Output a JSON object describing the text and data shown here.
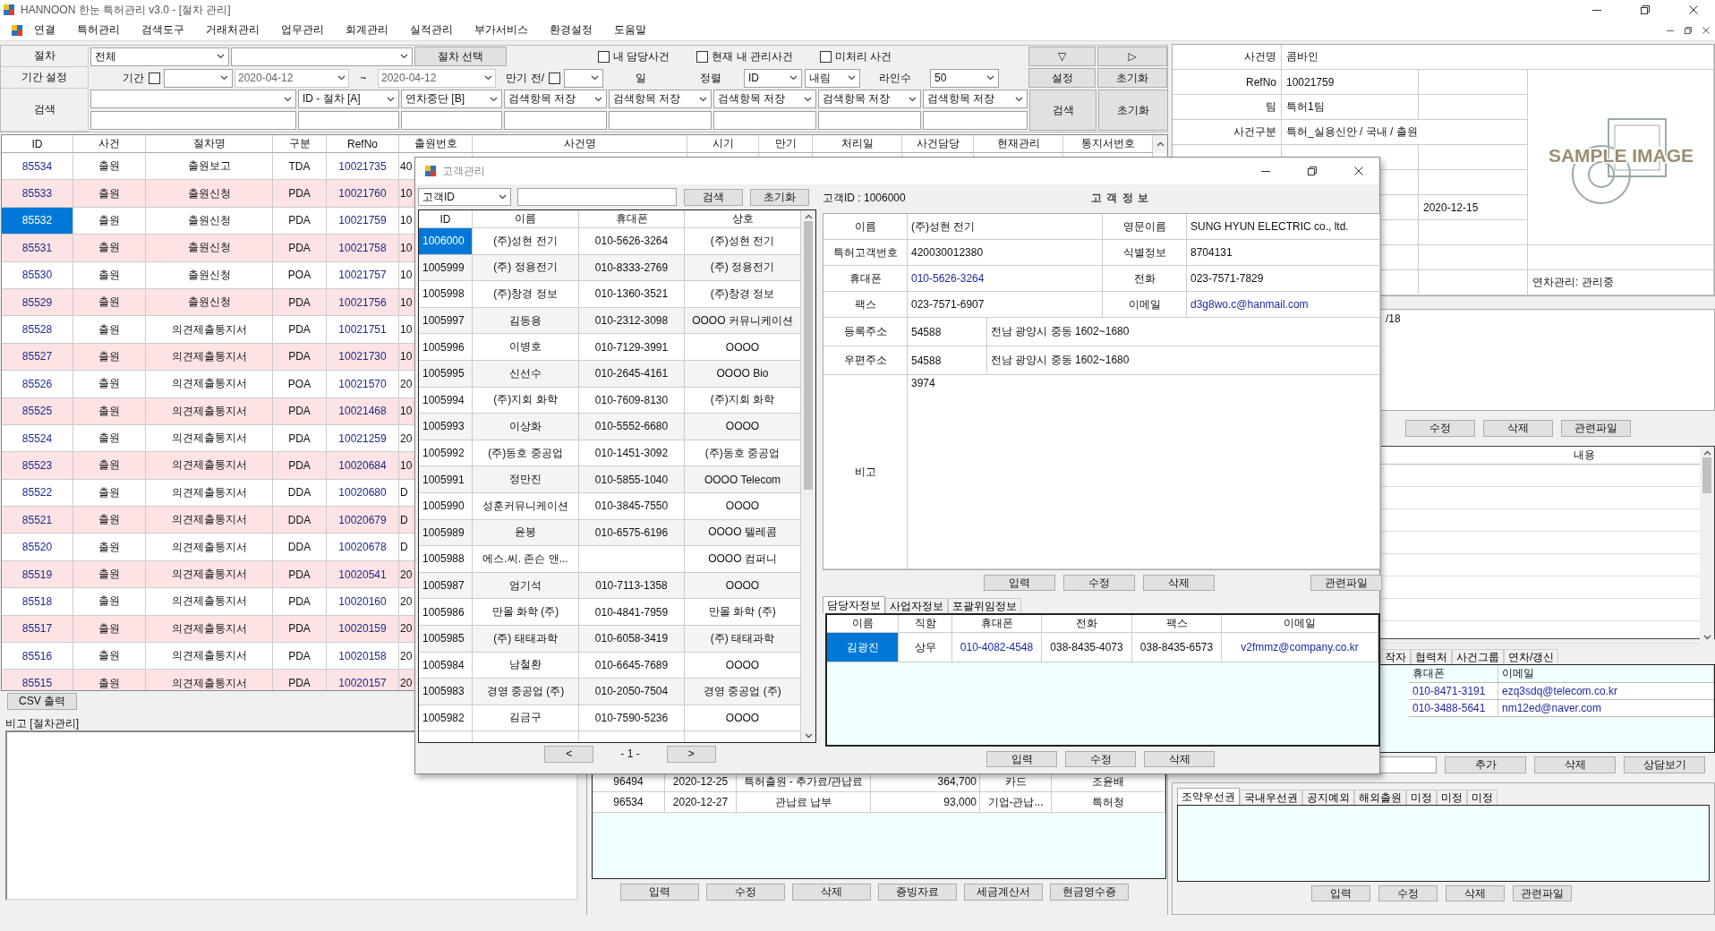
{
  "window": {
    "title": "HANNOON 한눈 특허관리 v3.0 - [절차 관리]"
  },
  "menu": [
    "연결",
    "특허관리",
    "검색도구",
    "거래처관리",
    "업무관리",
    "회계관리",
    "실적관리",
    "부가서비스",
    "환경설정",
    "도움말"
  ],
  "filter": {
    "row1": {
      "label": "절차",
      "procedure": "전체",
      "button": "절차 선택",
      "checkboxes": [
        {
          "label": "내 담당사건",
          "checked": false
        },
        {
          "label": "현재 내 관리사건",
          "checked": false
        },
        {
          "label": "미처리 사건",
          "checked": false
        }
      ],
      "nav_buttons": [
        "▽",
        "▷"
      ]
    },
    "row2": {
      "label": "기간 설정",
      "period_label": "기간",
      "period_checked": false,
      "date_from": "2020-04-12",
      "tilde": "~",
      "date_to": "2020-04-12",
      "due_label": "만기 전/",
      "due_checked": false,
      "day_label": "일",
      "sort_label": "정렬",
      "sort_field": "ID",
      "sort_order": "내림",
      "lines_label": "라인수",
      "lines": "50",
      "buttons": [
        "설정",
        "초기화"
      ]
    },
    "row3": {
      "label": "검색",
      "combos": [
        "ID - 절차  [A]",
        "연차중단  [B]",
        "검색항목 저장",
        "검색항목 저장",
        "검색항목 저장",
        "검색항목 저장",
        "검색항목 저장"
      ],
      "buttons": [
        "검색",
        "초기화"
      ]
    }
  },
  "procedure_table": {
    "columns": [
      "ID",
      "사건",
      "절차명",
      "구분",
      "RefNo",
      "출원번호",
      "사건명",
      "시기",
      "만기",
      "처리일",
      "사건담당",
      "현재관리",
      "통지서번호"
    ],
    "rows": [
      {
        "id": "85534",
        "case": "출원",
        "procedure": "출원보고",
        "type": "TDA",
        "ref_no": "10021735",
        "app_no": "40",
        "selected": false
      },
      {
        "id": "85533",
        "case": "출원",
        "procedure": "출원신청",
        "type": "PDA",
        "ref_no": "10021760",
        "app_no": "10",
        "selected": false
      },
      {
        "id": "85532",
        "case": "출원",
        "procedure": "출원신청",
        "type": "PDA",
        "ref_no": "10021759",
        "app_no": "10",
        "selected": true
      },
      {
        "id": "85531",
        "case": "출원",
        "procedure": "출원신청",
        "type": "PDA",
        "ref_no": "10021758",
        "app_no": "10",
        "selected": false
      },
      {
        "id": "85530",
        "case": "출원",
        "procedure": "출원신청",
        "type": "POA",
        "ref_no": "10021757",
        "app_no": "10",
        "selected": false
      },
      {
        "id": "85529",
        "case": "출원",
        "procedure": "출원신청",
        "type": "PDA",
        "ref_no": "10021756",
        "app_no": "10",
        "selected": false
      },
      {
        "id": "85528",
        "case": "출원",
        "procedure": "의견제출통지서",
        "type": "PDA",
        "ref_no": "10021751",
        "app_no": "10",
        "selected": false
      },
      {
        "id": "85527",
        "case": "출원",
        "procedure": "의견제출통지서",
        "type": "PDA",
        "ref_no": "10021730",
        "app_no": "10",
        "selected": false
      },
      {
        "id": "85526",
        "case": "출원",
        "procedure": "의견제출통지서",
        "type": "POA",
        "ref_no": "10021570",
        "app_no": "20",
        "selected": false
      },
      {
        "id": "85525",
        "case": "출원",
        "procedure": "의견제출통지서",
        "type": "PDA",
        "ref_no": "10021468",
        "app_no": "10",
        "selected": false
      },
      {
        "id": "85524",
        "case": "출원",
        "procedure": "의견제출통지서",
        "type": "PDA",
        "ref_no": "10021259",
        "app_no": "20",
        "selected": false
      },
      {
        "id": "85523",
        "case": "출원",
        "procedure": "의견제출통지서",
        "type": "PDA",
        "ref_no": "10020684",
        "app_no": "10",
        "selected": false
      },
      {
        "id": "85522",
        "case": "출원",
        "procedure": "의견제출통지서",
        "type": "DDA",
        "ref_no": "10020680",
        "app_no": "D",
        "selected": false
      },
      {
        "id": "85521",
        "case": "출원",
        "procedure": "의견제출통지서",
        "type": "DDA",
        "ref_no": "10020679",
        "app_no": "D",
        "selected": false
      },
      {
        "id": "85520",
        "case": "출원",
        "procedure": "의견제출통지서",
        "type": "DDA",
        "ref_no": "10020678",
        "app_no": "D",
        "selected": false
      },
      {
        "id": "85519",
        "case": "출원",
        "procedure": "의견제출통지서",
        "type": "PDA",
        "ref_no": "10020541",
        "app_no": "20",
        "selected": false
      },
      {
        "id": "85518",
        "case": "출원",
        "procedure": "의견제출통지서",
        "type": "PDA",
        "ref_no": "10020160",
        "app_no": "20",
        "selected": false
      },
      {
        "id": "85517",
        "case": "출원",
        "procedure": "의견제출통지서",
        "type": "PDA",
        "ref_no": "10020159",
        "app_no": "20",
        "selected": false
      },
      {
        "id": "85516",
        "case": "출원",
        "procedure": "의견제출통지서",
        "type": "PDA",
        "ref_no": "10020158",
        "app_no": "20",
        "selected": false
      },
      {
        "id": "85515",
        "case": "출원",
        "procedure": "의견제출통지서",
        "type": "PDA",
        "ref_no": "10020157",
        "app_no": "20",
        "selected": false
      }
    ]
  },
  "csv_button": "CSV 출력",
  "memo": {
    "label": "비고 [절차관리]"
  },
  "payments": {
    "rows": [
      {
        "no": "96494",
        "date": "2020-12-25",
        "item": "특허출원 - 추가료/관납료",
        "amount": "364,700",
        "method": "카드",
        "payee": "조윤배"
      },
      {
        "no": "96534",
        "date": "2020-12-27",
        "item": "관납료 납부",
        "amount": "93,000",
        "method": "기업-관납...",
        "payee": "특허청"
      }
    ],
    "buttons": [
      "입력",
      "수정",
      "삭제",
      "증빙자료",
      "세금계산서",
      "현금영수증"
    ]
  },
  "case_info": {
    "rows": [
      {
        "label": "사건명",
        "value": "콤바인"
      },
      {
        "label": "RefNo",
        "value": "10021759"
      },
      {
        "label": "팀",
        "value": "특허1팀"
      },
      {
        "label": "사건구분",
        "value": "특허_실용신안 / 국내 / 출원"
      }
    ],
    "date": "2020-12-15",
    "annuity_status": "연차관리: 관리중",
    "image_text": "SAMPLE IMAGE"
  },
  "case_memo": {
    "text": "/18",
    "buttons": [
      "수정",
      "삭제",
      "관련파일"
    ]
  },
  "content_table": {
    "columns": [
      "내용"
    ]
  },
  "case_tabs": [
    {
      "label": "작자",
      "selected": false
    },
    {
      "label": "협력처",
      "selected": false
    },
    {
      "label": "사건그룹",
      "selected": false
    },
    {
      "label": "연차/갱신",
      "selected": false
    }
  ],
  "case_contacts": {
    "columns": [
      "휴대폰",
      "이메일"
    ],
    "rows": [
      {
        "mobile": "010-8471-3191",
        "email": "ezq3sdq@telecom.co.kr"
      },
      {
        "mobile": "010-3488-5641",
        "email": "nm12ed@naver.com"
      }
    ],
    "buttons": [
      "추가",
      "삭제",
      "상담보기"
    ]
  },
  "priority": {
    "tabs": [
      {
        "label": "조약우선권",
        "selected": true
      },
      {
        "label": "국내우선권",
        "selected": false
      },
      {
        "label": "공지예외",
        "selected": false
      },
      {
        "label": "해외출원",
        "selected": false
      },
      {
        "label": "미정",
        "selected": false
      },
      {
        "label": "미정",
        "selected": false
      },
      {
        "label": "미정",
        "selected": false
      }
    ],
    "buttons": [
      "입력",
      "수정",
      "삭제",
      "관련파일"
    ]
  },
  "customer_dialog": {
    "title": "고객관리",
    "search_field": "고객ID",
    "search_buttons": [
      "검색",
      "초기화"
    ],
    "list": {
      "columns": [
        "ID",
        "이름",
        "휴대폰",
        "상호"
      ],
      "rows": [
        {
          "id": "1006000",
          "name": "(주)성현 전기",
          "mobile": "010-5626-3264",
          "company": "(주)성현 전기",
          "selected": true
        },
        {
          "id": "1005999",
          "name": "(주) 정용전기",
          "mobile": "010-8333-2769",
          "company": "(주) 정용전기",
          "selected": false
        },
        {
          "id": "1005998",
          "name": "(주)창경 정보",
          "mobile": "010-1360-3521",
          "company": "(주)창경 정보",
          "selected": false
        },
        {
          "id": "1005997",
          "name": "김동용",
          "mobile": "010-2312-3098",
          "company": "OOOO 커뮤니케이션",
          "selected": false
        },
        {
          "id": "1005996",
          "name": "이병호",
          "mobile": "010-7129-3991",
          "company": "OOOO",
          "selected": false
        },
        {
          "id": "1005995",
          "name": "신선수",
          "mobile": "010-2645-4161",
          "company": "OOOO Bio",
          "selected": false
        },
        {
          "id": "1005994",
          "name": "(주)지회 화학",
          "mobile": "010-7609-8130",
          "company": "(주)지회 화학",
          "selected": false
        },
        {
          "id": "1005993",
          "name": "이상화",
          "mobile": "010-5552-6680",
          "company": "OOOO",
          "selected": false
        },
        {
          "id": "1005992",
          "name": "(주)동호 중공업",
          "mobile": "010-1451-3092",
          "company": "(주)동호 중공업",
          "selected": false
        },
        {
          "id": "1005991",
          "name": "정만진",
          "mobile": "010-5855-1040",
          "company": "OOOO Telecom",
          "selected": false
        },
        {
          "id": "1005990",
          "name": "성훈커뮤니케이션",
          "mobile": "010-3845-7550",
          "company": "OOOO",
          "selected": false
        },
        {
          "id": "1005989",
          "name": "윤봉",
          "mobile": "010-6575-6196",
          "company": "OOOO 텔레콤",
          "selected": false
        },
        {
          "id": "1005988",
          "name": "에스.씨. 존슨 앤...",
          "company": "OOOO 컴퍼니",
          "selected": false
        },
        {
          "id": "1005987",
          "name": "엄기석",
          "mobile": "010-7113-1358",
          "company": "OOOO",
          "selected": false
        },
        {
          "id": "1005986",
          "name": "만몰 화학 (주)",
          "mobile": "010-4841-7959",
          "company": "만몰 화학 (주)",
          "selected": false
        },
        {
          "id": "1005985",
          "name": "(주) 태태과학",
          "mobile": "010-6058-3419",
          "company": "(주) 태태과학",
          "selected": false
        },
        {
          "id": "1005984",
          "name": "남철환",
          "mobile": "010-6645-7689",
          "company": "OOOO",
          "selected": false
        },
        {
          "id": "1005983",
          "name": "경영 중공업 (주)",
          "mobile": "010-2050-7504",
          "company": "경영 중공업 (주)",
          "selected": false
        },
        {
          "id": "1005982",
          "name": "김금구",
          "mobile": "010-7590-5236",
          "company": "OOOO",
          "selected": false
        }
      ]
    },
    "pager": {
      "prev": "<",
      "page": "- 1 -",
      "next": ">"
    },
    "info": {
      "id_label": "고객ID : 1006000",
      "heading": "고 객 정 보",
      "fields": [
        {
          "label": "이름",
          "value": "(주)성현 전기",
          "kind": "text"
        },
        {
          "label": "영문이름",
          "value": "SUNG HYUN ELECTRIC co., ltd.",
          "kind": "text"
        },
        {
          "label": "특허고객번호",
          "value": "420030012380",
          "kind": "text"
        },
        {
          "label": "식별정보",
          "value": "8704131",
          "kind": "text"
        },
        {
          "label": "휴대폰",
          "value": "010-5626-3264",
          "kind": "link"
        },
        {
          "label": "전화",
          "value": "023-7571-7829",
          "kind": "text"
        },
        {
          "label": "팩스",
          "value": "023-7571-6907",
          "kind": "text"
        },
        {
          "label": "이메일",
          "value": "d3g8wo.c@hanmail.com",
          "kind": "link"
        }
      ],
      "addresses": [
        {
          "label": "등록주소",
          "zip": "54588",
          "address": "전남 광양시 중동 1602~1680"
        },
        {
          "label": "우편주소",
          "zip": "54588",
          "address": "전남 광양시 중동 1602~1680"
        }
      ],
      "memo_label": "비고",
      "memo": "3974",
      "buttons": [
        "입력",
        "수정",
        "삭제"
      ],
      "file_button": "관련파일"
    },
    "tabs": [
      {
        "label": "담당자정보",
        "selected": true
      },
      {
        "label": "사업자정보",
        "selected": false
      },
      {
        "label": "포괄위임정보",
        "selected": false
      }
    ],
    "contacts": {
      "columns": [
        "이름",
        "직함",
        "휴대폰",
        "전화",
        "팩스",
        "이메일"
      ],
      "rows": [
        {
          "name": "김광진",
          "title": "상무",
          "mobile": "010-4082-4548",
          "phone": "038-8435-4073",
          "fax": "038-8435-6573",
          "email": "v2fmmz@company.co.kr",
          "selected": true
        }
      ]
    },
    "contact_buttons": [
      "입력",
      "수정",
      "삭제"
    ]
  }
}
